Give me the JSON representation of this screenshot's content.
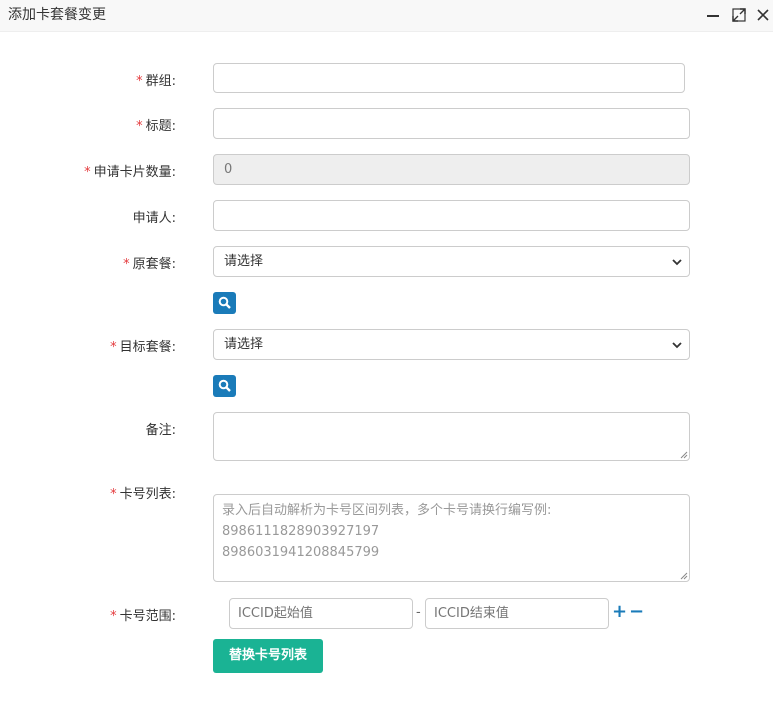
{
  "window": {
    "title": "添加卡套餐变更"
  },
  "form": {
    "group_label": "群组:",
    "title_label": "标题:",
    "card_count_label": "申请卡片数量:",
    "card_count_value": "0",
    "applicant_label": "申请人:",
    "orig_plan_label": "原套餐:",
    "orig_plan_value": "请选择",
    "target_plan_label": "目标套餐:",
    "target_plan_value": "请选择",
    "remark_label": "备注:",
    "card_list_label": "卡号列表:",
    "card_list_placeholder": "录入后自动解析为卡号区间列表，多个卡号请换行编写例:\n8986111828903927197\n8986031941208845799",
    "card_range_label": "卡号范围:",
    "iccid_start_placeholder": "ICCID起始值",
    "iccid_end_placeholder": "ICCID结束值",
    "range_separator": "-",
    "plus": "+",
    "minus": "−",
    "replace_button": "替换卡号列表",
    "required_mark": "*"
  },
  "colors": {
    "primary": "#1ab394",
    "accent": "#1a7bb9",
    "required": "#e4393c"
  }
}
